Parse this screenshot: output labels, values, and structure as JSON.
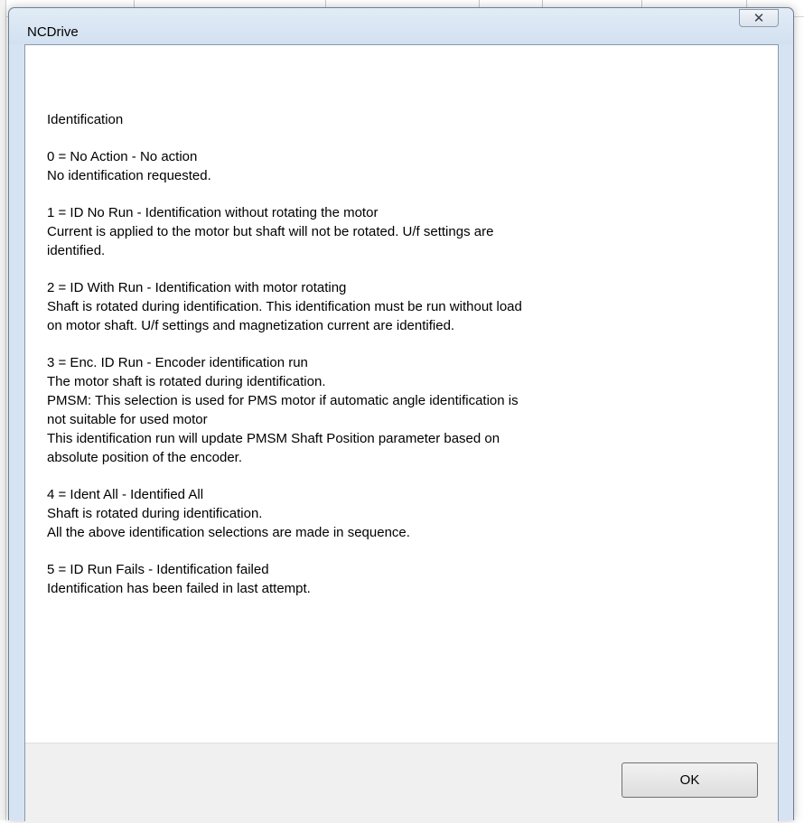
{
  "window": {
    "title": "NCDrive",
    "close_glyph": "✕"
  },
  "help": {
    "heading": "Identification",
    "options": [
      {
        "title": "0 = No Action - No action",
        "lines": [
          "No identification requested."
        ]
      },
      {
        "title": "1 = ID No Run - Identification without rotating the motor",
        "lines": [
          "Current is applied to the motor but shaft will not be rotated. U/f settings are",
          "identified."
        ]
      },
      {
        "title": "2 = ID With Run - Identification with motor rotating",
        "lines": [
          "Shaft is rotated during identification. This identification must be run without load",
          "on motor shaft. U/f settings and magnetization current are identified."
        ]
      },
      {
        "title": "3 = Enc. ID Run - Encoder identification run",
        "lines": [
          "The motor shaft is rotated during identification.",
          "PMSM: This selection is used for PMS motor if automatic angle identification is",
          "not suitable for used motor",
          "This identification run will update PMSM Shaft Position parameter based on",
          "absolute position of the encoder."
        ]
      },
      {
        "title": "4 = Ident All - Identified All",
        "lines": [
          "Shaft is rotated during identification.",
          "All the above identification selections are made in sequence."
        ]
      },
      {
        "title": "5 = ID Run Fails - Identification failed",
        "lines": [
          "Identification has been failed in last attempt."
        ]
      }
    ]
  },
  "buttons": {
    "ok_label": "OK"
  }
}
